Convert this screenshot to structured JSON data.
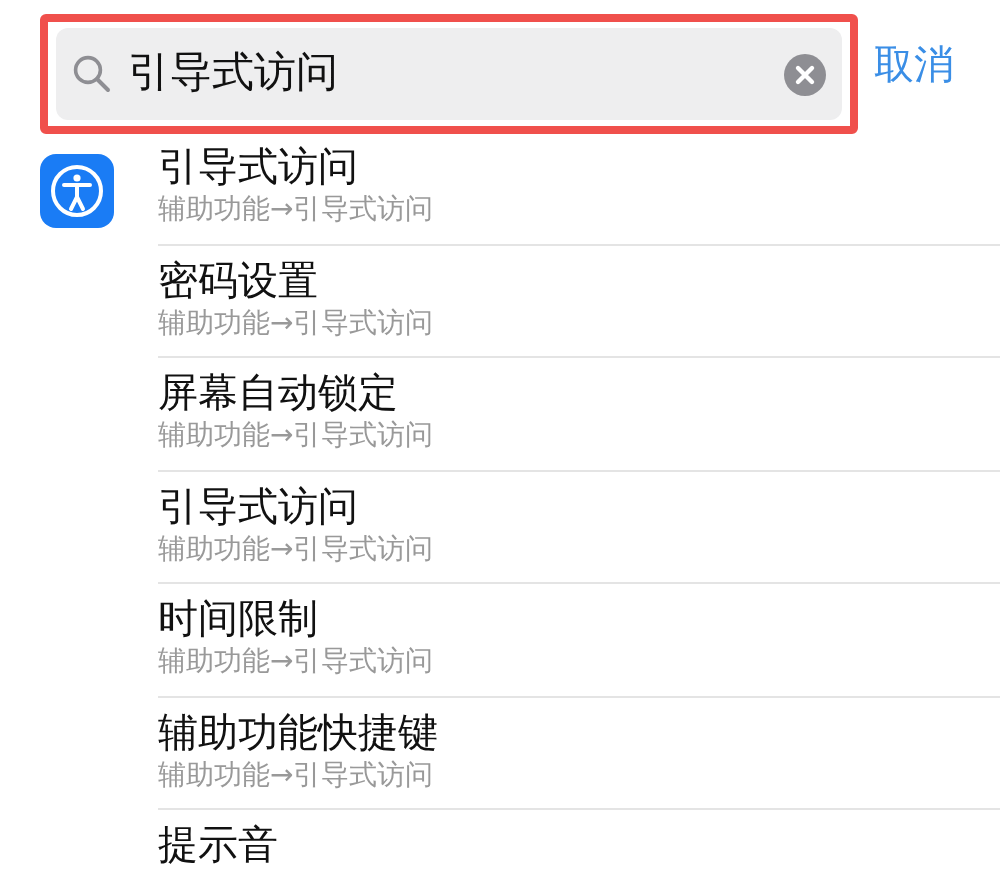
{
  "search": {
    "value": "引导式访问",
    "highlighted": true,
    "cancel": "取消"
  },
  "results": [
    {
      "title": "引导式访问",
      "subtitle": "辅助功能→引导式访问",
      "icon": true
    },
    {
      "title": "密码设置",
      "subtitle": "辅助功能→引导式访问",
      "icon": false
    },
    {
      "title": "屏幕自动锁定",
      "subtitle": "辅助功能→引导式访问",
      "icon": false
    },
    {
      "title": "引导式访问",
      "subtitle": "辅助功能→引导式访问",
      "icon": false
    },
    {
      "title": "时间限制",
      "subtitle": "辅助功能→引导式访问",
      "icon": false
    },
    {
      "title": "辅助功能快捷键",
      "subtitle": "辅助功能→引导式访问",
      "icon": false
    },
    {
      "title": "提示音",
      "icon": false
    }
  ]
}
